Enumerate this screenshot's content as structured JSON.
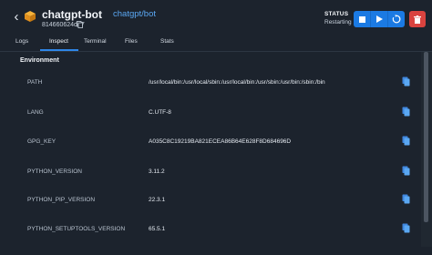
{
  "header": {
    "back_icon": "chevron-left-icon",
    "container_icon": "box-icon",
    "title": "chatgpt-bot",
    "image": "chatgpt/bot",
    "container_id": "814660624de7",
    "status_label": "STATUS",
    "status_value": "Restarting",
    "actions": [
      "stop-icon",
      "play-icon",
      "restart-icon",
      "trash-icon"
    ]
  },
  "tabs": [
    {
      "label": "Logs",
      "active": false
    },
    {
      "label": "Inspect",
      "active": true
    },
    {
      "label": "Terminal",
      "active": false
    },
    {
      "label": "Files",
      "active": false
    },
    {
      "label": "Stats",
      "active": false
    }
  ],
  "section": {
    "title": "Environment"
  },
  "env": [
    {
      "key": "PATH",
      "value": "/usr/local/bin:/usr/local/sbin:/usr/local/bin:/usr/sbin:/usr/bin:/sbin:/bin"
    },
    {
      "key": "LANG",
      "value": "C.UTF-8"
    },
    {
      "key": "GPG_KEY",
      "value": "A035C8C19219BA821ECEA86B64E628F8D684696D"
    },
    {
      "key": "PYTHON_VERSION",
      "value": "3.11.2"
    },
    {
      "key": "PYTHON_PIP_VERSION",
      "value": "22.3.1"
    },
    {
      "key": "PYTHON_SETUPTOOLS_VERSION",
      "value": "65.5.1"
    }
  ],
  "colors": {
    "background": "#1c232d",
    "accent": "#2f86e8",
    "primary_button": "#1b7ae3",
    "danger_button": "#d9433f",
    "link": "#5aa7f2"
  }
}
